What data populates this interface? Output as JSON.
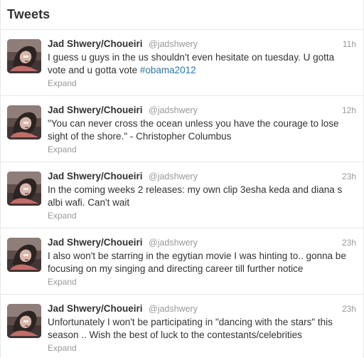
{
  "header": {
    "title": "Tweets"
  },
  "tweets": [
    {
      "name": "Jad Shwery/Choueiri",
      "handle": "@jadshwery",
      "time": "11h",
      "text": "I guess u guys in the us shouldn't even hesitate on tuesday. U gotta vote and u gotta vote ",
      "hashtag": "#obama2012",
      "expand": "Expand"
    },
    {
      "name": "Jad Shwery/Choueiri",
      "handle": "@jadshwery",
      "time": "12h",
      "text": "\"You can never cross the ocean unless you have the courage to lose sight of the shore.\" - Christopher Columbus",
      "expand": "Expand"
    },
    {
      "name": "Jad Shwery/Choueiri",
      "handle": "@jadshwery",
      "time": "23h",
      "text": "In the coming weeks 2 releases: my own clip 3esha keda and diana s albi wafi. Can't wait",
      "expand": "Expand"
    },
    {
      "name": "Jad Shwery/Choueiri",
      "handle": "@jadshwery",
      "time": "23h",
      "text": "I also won't be starring in the egytian movie I was hinting to.. gonna be focusing on my singing and directing career till further notice",
      "expand": "Expand"
    },
    {
      "name": "Jad Shwery/Choueiri",
      "handle": "@jadshwery",
      "time": "23h",
      "text": "Unfortunately I won't be participating in \"dancing with the stars\" this season .. Wish the best of luck to the contestants/celebrities",
      "expand": "Expand"
    }
  ]
}
